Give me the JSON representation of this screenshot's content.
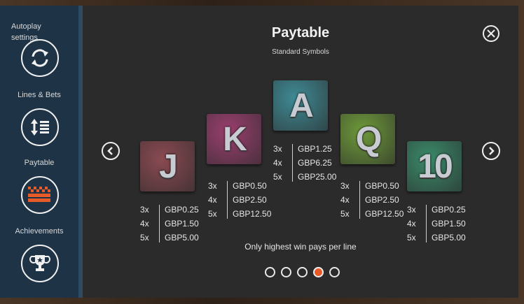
{
  "sidebar": {
    "items": [
      {
        "label": "Autoplay settings",
        "icon": "refresh-icon"
      },
      {
        "label": "Lines & Bets",
        "icon": "lines-bets-icon"
      },
      {
        "label": "Paytable",
        "icon": "paytable-icon",
        "active": true
      },
      {
        "label": "Achievements",
        "icon": "trophy-icon"
      }
    ]
  },
  "header": {
    "title": "Paytable",
    "subtitle": "Standard Symbols"
  },
  "symbols": [
    {
      "glyph": "J",
      "color": "#8a4a52",
      "pays": [
        {
          "count": "3x",
          "value": "GBP0.25"
        },
        {
          "count": "4x",
          "value": "GBP1.50"
        },
        {
          "count": "5x",
          "value": "GBP5.00"
        }
      ]
    },
    {
      "glyph": "K",
      "color": "#9a3f6e",
      "pays": [
        {
          "count": "3x",
          "value": "GBP0.50"
        },
        {
          "count": "4x",
          "value": "GBP2.50"
        },
        {
          "count": "5x",
          "value": "GBP12.50"
        }
      ]
    },
    {
      "glyph": "A",
      "color": "#3f8a94",
      "pays": [
        {
          "count": "3x",
          "value": "GBP1.25"
        },
        {
          "count": "4x",
          "value": "GBP6.25"
        },
        {
          "count": "5x",
          "value": "GBP25.00"
        }
      ]
    },
    {
      "glyph": "Q",
      "color": "#6e9a3a",
      "pays": [
        {
          "count": "3x",
          "value": "GBP0.50"
        },
        {
          "count": "4x",
          "value": "GBP2.50"
        },
        {
          "count": "5x",
          "value": "GBP12.50"
        }
      ]
    },
    {
      "glyph": "10",
      "color": "#3a8a6a",
      "pays": [
        {
          "count": "3x",
          "value": "GBP0.25"
        },
        {
          "count": "4x",
          "value": "GBP1.50"
        },
        {
          "count": "5x",
          "value": "GBP5.00"
        }
      ]
    }
  ],
  "footnote": "Only highest win pays per line",
  "pagination": {
    "pages": 5,
    "current": 4
  },
  "colors": {
    "accent": "#e85a27",
    "panel": "#2b2b2b",
    "sidebar": "#1e3346"
  }
}
